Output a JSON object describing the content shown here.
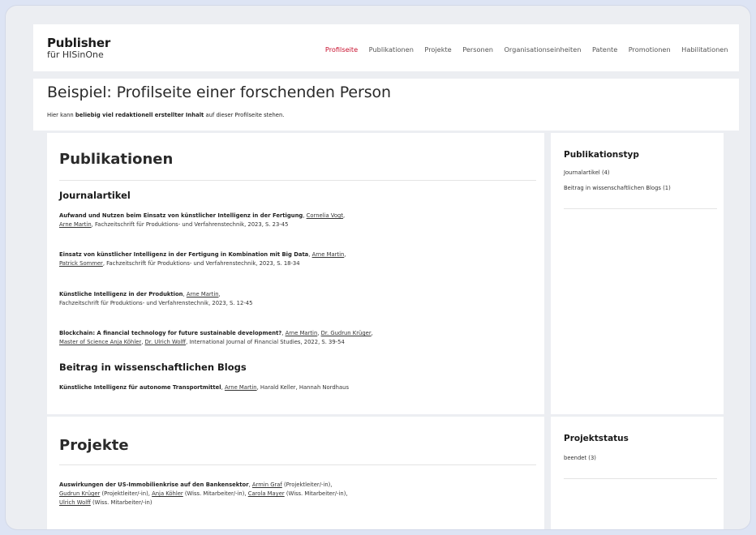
{
  "header": {
    "brand": "Publisher",
    "brand_sub": "für HISinOne",
    "nav": [
      {
        "label": "Profilseite",
        "active": true
      },
      {
        "label": "Publikationen"
      },
      {
        "label": "Projekte"
      },
      {
        "label": "Personen"
      },
      {
        "label": "Organisationseinheiten"
      },
      {
        "label": "Patente"
      },
      {
        "label": "Promotionen"
      },
      {
        "label": "Habilitationen"
      }
    ]
  },
  "page": {
    "title": "Beispiel: Profilseite einer forschenden Person",
    "intro_prefix": "Hier kann ",
    "intro_bold": "beliebig viel redaktionell erstellter Inhalt",
    "intro_suffix": " auf dieser Profilseite stehen."
  },
  "publications": {
    "title": "Publikationen",
    "journal": {
      "heading": "Journalartikel",
      "entries": [
        {
          "title": "Aufwand und Nutzen beim Einsatz von künstlicher Intelligenz in der Fertigung",
          "sep1": ", ",
          "author1": "Cornelia Vogt",
          "sep2": ",",
          "author2": "Arne Martin",
          "rest": ", Fachzeitschrift für Produktions- und Verfahrenstechnik, 2023, S. 23-45"
        },
        {
          "title": "Einsatz von künstlicher Intelligenz in der Fertigung in Kombination mit Big Data",
          "sep1": ", ",
          "author1": "Arne Martin",
          "sep2": ",",
          "author2": "Patrick Sommer",
          "rest": ", Fachzeitschrift für Produktions- und Verfahrenstechnik, 2023, S. 18-34"
        },
        {
          "title": "Künstliche Intelligenz in der Produktion",
          "sep1": ", ",
          "author1": "Arne Martin",
          "sep2": ",",
          "rest": "Fachzeitschrift für Produktions- und Verfahrenstechnik, 2023, S. 12-45"
        },
        {
          "title": "Blockchain: A financial technology for future sustainable development?",
          "sep1": ", ",
          "author1": "Arne Martin",
          "sep2": ", ",
          "author2": "Dr. Gudrun Krüger",
          "sep3": ",",
          "author3": "Master of Science Anja Köhler",
          "sep4": ", ",
          "author4": "Dr. Ulrich Wolff",
          "rest": ", International Journal of Financial Studies, 2022, S. 39-54"
        }
      ]
    },
    "blogs": {
      "heading": "Beitrag in wissenschaftlichen Blogs",
      "entries": [
        {
          "title": "Künstliche Intelligenz für autonome Transportmittel",
          "sep1": ", ",
          "author1": "Arne Martin",
          "rest": ", Harald Keller, Hannah Nordhaus"
        }
      ]
    }
  },
  "facet_pub": {
    "title": "Publikationstyp",
    "items": [
      "Journalartikel (4)",
      "Beitrag in wissenschaftlichen Blogs (1)"
    ]
  },
  "projects": {
    "title": "Projekte",
    "entries": [
      {
        "title": "Auswirkungen der US-Immobilienkrise auf den Bankensektor",
        "sep1": ", ",
        "p1": "Armin Graf",
        "r1": " (Projektleiter/-in),",
        "p2": "Gudrun Krüger",
        "r2": " (Projektleiter/-in), ",
        "p3": "Anja Köhler",
        "r3": " (Wiss. Mitarbeiter/-in), ",
        "p4": "Carola Mayer",
        "r4": " (Wiss. Mitarbeiter/-in),",
        "p5": "Ulrich Wolff",
        "r5": " (Wiss. Mitarbeiter/-in)"
      }
    ]
  },
  "facet_proj": {
    "title": "Projektstatus",
    "items": [
      "beendet (3)"
    ]
  }
}
